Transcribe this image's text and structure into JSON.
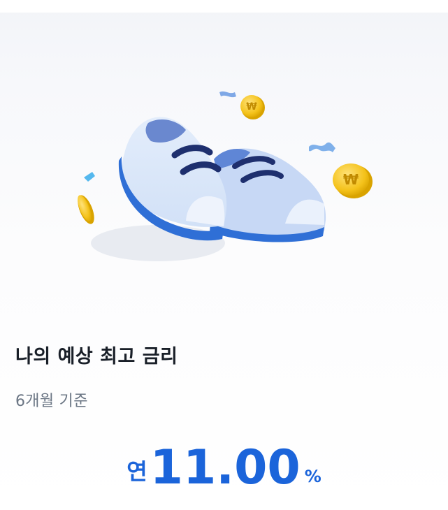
{
  "hero": {
    "illustration": "blue-sneakers-with-coins"
  },
  "colors": {
    "accent": "#1b64da",
    "title": "#191f28",
    "subtitle": "#6b7684",
    "coin": "#f5c518"
  },
  "content": {
    "title": "나의 예상 최고 금리",
    "subtitle": "6개월 기준",
    "rate_prefix": "연",
    "rate_value": "11.00",
    "rate_unit": "%"
  }
}
